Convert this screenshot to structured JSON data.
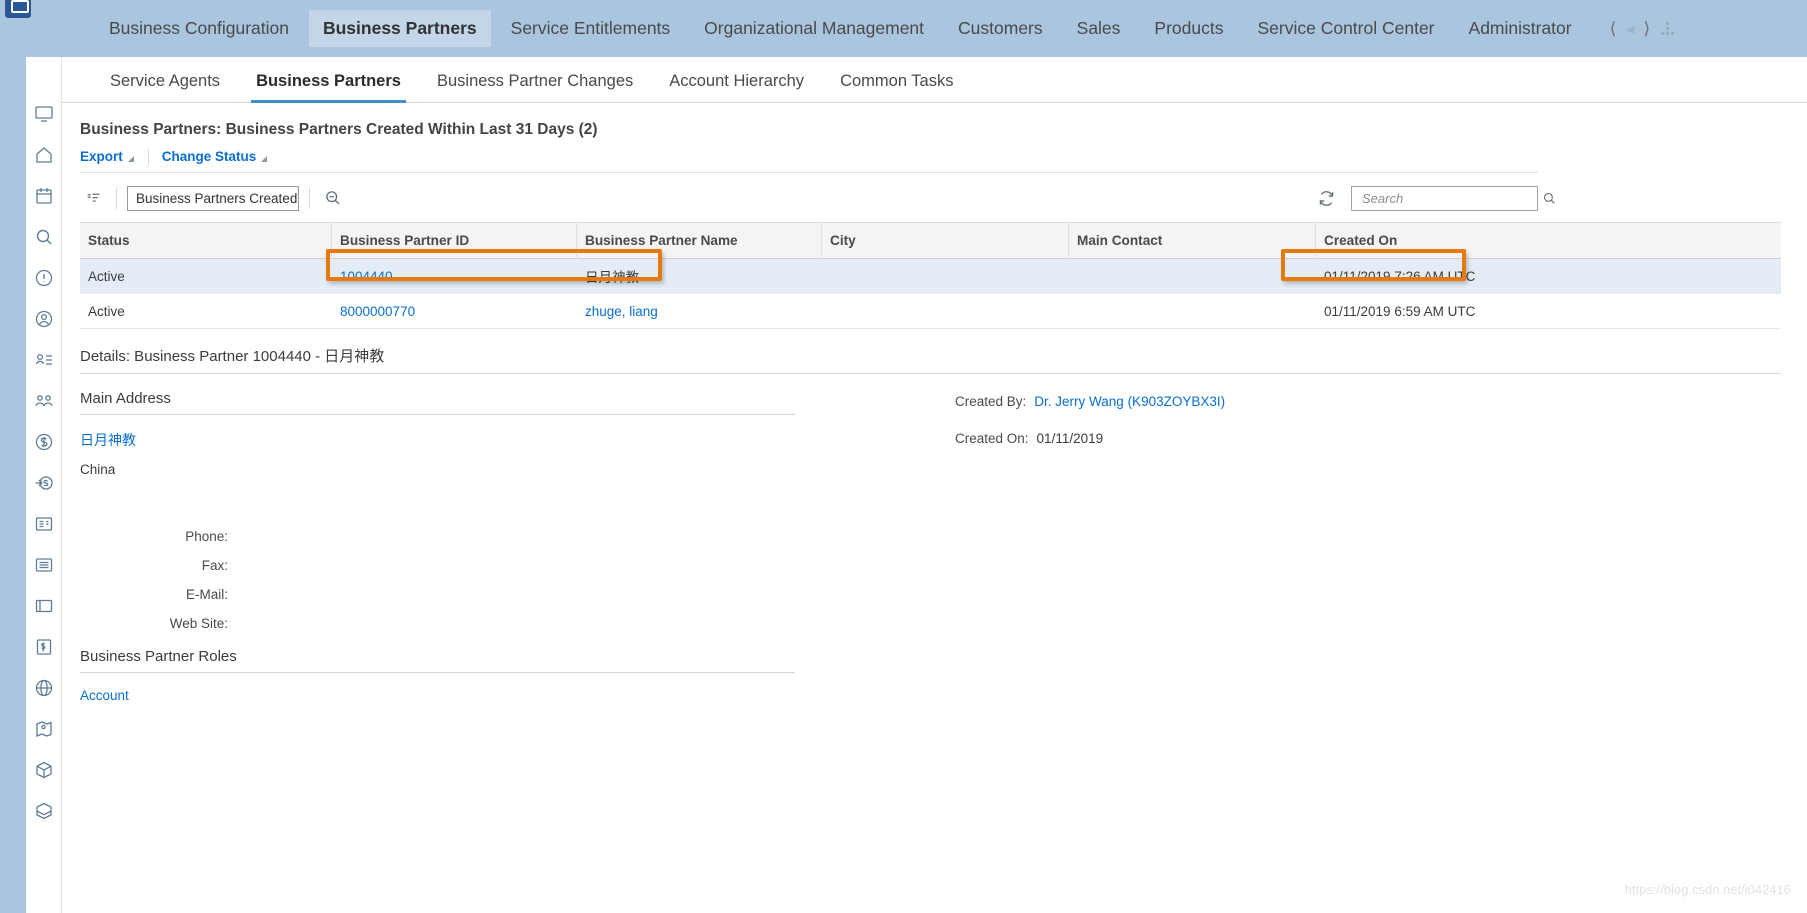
{
  "topnav": {
    "items": [
      {
        "label": "Business Configuration",
        "active": false
      },
      {
        "label": "Business Partners",
        "active": true
      },
      {
        "label": "Service Entitlements",
        "active": false
      },
      {
        "label": "Organizational Management",
        "active": false
      },
      {
        "label": "Customers",
        "active": false
      },
      {
        "label": "Sales",
        "active": false
      },
      {
        "label": "Products",
        "active": false
      },
      {
        "label": "Service Control Center",
        "active": false
      },
      {
        "label": "Administrator",
        "active": false
      }
    ],
    "prev_icon": "chevron-left-icon",
    "next_icon": "chevron-right-icon",
    "more_icon": "more-dots-icon"
  },
  "rail": {
    "icons": [
      "screen-icon",
      "home-icon",
      "calendar-icon",
      "search-icon",
      "alert-icon",
      "user-icon",
      "contacts-icon",
      "group-icon",
      "currency-icon",
      "payment-icon",
      "form-icon",
      "list-icon",
      "card-icon",
      "invoice-icon",
      "globe-icon",
      "location-icon",
      "box-icon",
      "layers-icon"
    ]
  },
  "subtabs": [
    {
      "label": "Service Agents",
      "active": false
    },
    {
      "label": "Business Partners",
      "active": true
    },
    {
      "label": "Business Partner Changes",
      "active": false
    },
    {
      "label": "Account Hierarchy",
      "active": false
    },
    {
      "label": "Common Tasks",
      "active": false
    }
  ],
  "page": {
    "title": "Business Partners: Business Partners Created Within Last 31 Days (2)"
  },
  "toolbar": {
    "export_label": "Export",
    "change_status_label": "Change Status",
    "sort_icon": "sort-filter-icon",
    "zoom_icon": "zoom-out-icon",
    "refresh_icon": "refresh-icon",
    "view_selected": "Business Partners Created \\",
    "search_placeholder": "Search",
    "search_value": "",
    "search_icon": "magnifier-icon"
  },
  "table": {
    "columns": [
      "Status",
      "Business Partner ID",
      "Business Partner Name",
      "City",
      "Main Contact",
      "Created On"
    ],
    "rows": [
      {
        "status": "Active",
        "id": "1004440",
        "name": "日月神教",
        "city": "",
        "contact": "",
        "created_on": "01/11/2019 7:26 AM UTC",
        "selected": true
      },
      {
        "status": "Active",
        "id": "8000000770",
        "name": "zhuge, liang",
        "city": "",
        "contact": "",
        "created_on": "01/11/2019 6:59 AM UTC",
        "selected": false
      }
    ]
  },
  "details": {
    "title": "Details: Business Partner 1004440 - 日月神教",
    "main_address_head": "Main Address",
    "address_name": "日月神教",
    "address_country": "China",
    "fields": [
      {
        "label": "Phone:",
        "value": ""
      },
      {
        "label": "Fax:",
        "value": ""
      },
      {
        "label": "E-Mail:",
        "value": ""
      },
      {
        "label": "Web Site:",
        "value": ""
      }
    ],
    "roles_head": "Business Partner Roles",
    "role": "Account",
    "created_by_label": "Created By:",
    "created_by_value": "Dr. Jerry Wang (K903ZOYBX3I)",
    "created_on_label": "Created On:",
    "created_on_value": "01/11/2019"
  },
  "watermark": "https://blog.csdn.net/i042416",
  "colors": {
    "topbar": "#aac5de",
    "accent_link": "#0a6ed1",
    "tab_underline": "#3f8ecc",
    "highlight": "#e8790c",
    "row_selected": "#e4edf6"
  }
}
